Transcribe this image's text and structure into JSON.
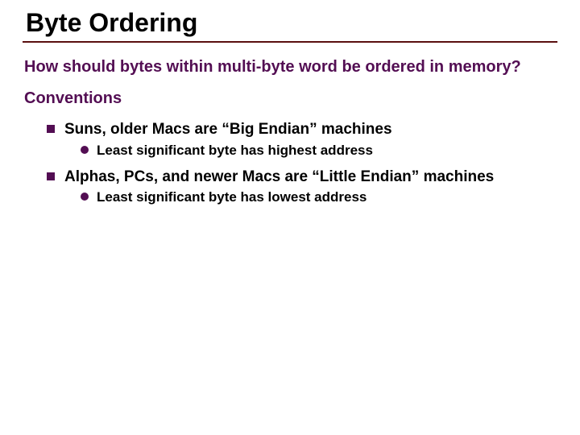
{
  "title": "Byte Ordering",
  "question": "How should bytes within multi-byte word be ordered in memory?",
  "section": "Conventions",
  "items": [
    {
      "text": "Suns, older Macs are “Big Endian” machines",
      "sub": "Least significant byte has highest address"
    },
    {
      "text": "Alphas, PCs, and newer Macs are “Little Endian” machines",
      "sub": "Least significant byte has lowest address"
    }
  ]
}
